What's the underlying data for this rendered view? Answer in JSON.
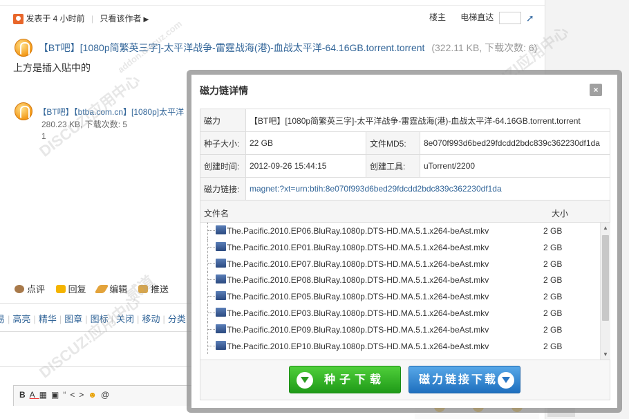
{
  "post": {
    "posted_time": "发表于 4 小时前",
    "only_author": "只看该作者",
    "floor_label": "楼主",
    "elevator_label": "电梯直达",
    "attachment1": {
      "link_text": "【BT吧】[1080p简繁英三字]-太平洋战争-雷霆战海(港)-血战太平洋-64.16GB.torrent.torrent",
      "info": "(322.11 KB, 下载次数: 6)"
    },
    "body_text": "上方是插入贴中的",
    "attachment2": {
      "link_text": "【BT吧】【btba.com.cn】[1080p]太平洋",
      "size_downloads": "280.23 KB, 下载次数: 5",
      "count": "1"
    },
    "actions": [
      "点评",
      "回复",
      "编辑",
      "推送"
    ],
    "admin_actions": [
      "易",
      "高亮",
      "精华",
      "图章",
      "图标",
      "关闭",
      "移动",
      "分类"
    ]
  },
  "editor": {
    "toolbar_items": [
      "B",
      "A",
      "▦",
      "▣",
      "“",
      "<>",
      "☻",
      "@"
    ]
  },
  "watermark": {
    "text1": "DISCUZ!应用中心",
    "text2": "addon.discuz.com",
    "text3": "贰道"
  },
  "modal": {
    "title": "磁力链详情",
    "close": "×",
    "rows": {
      "magnet_label": "磁力",
      "magnet_name": "【BT吧】[1080p简繁英三字]-太平洋战争-雷霆战海(港)-血战太平洋-64.16GB.torrent.torrent",
      "size_label": "种子大小:",
      "size_value": "22 GB",
      "md5_label": "文件MD5:",
      "md5_value": "8e070f993d6bed29fdcdd2bdc839c362230df1da",
      "created_label": "创建时间:",
      "created_value": "2012-09-26 15:44:15",
      "tool_label": "创建工具:",
      "tool_value": "uTorrent/2200",
      "link_label": "磁力链接:",
      "link_value": "magnet:?xt=urn:btih:8e070f993d6bed29fdcdd2bdc839c362230df1da"
    },
    "file_header": {
      "name": "文件名",
      "size": "大小"
    },
    "files": [
      {
        "name": "The.Pacific.2010.EP06.BluRay.1080p.DTS-HD.MA.5.1.x264-beAst.mkv",
        "size": "2 GB"
      },
      {
        "name": "The.Pacific.2010.EP01.BluRay.1080p.DTS-HD.MA.5.1.x264-beAst.mkv",
        "size": "2 GB"
      },
      {
        "name": "The.Pacific.2010.EP07.BluRay.1080p.DTS-HD.MA.5.1.x264-beAst.mkv",
        "size": "2 GB"
      },
      {
        "name": "The.Pacific.2010.EP08.BluRay.1080p.DTS-HD.MA.5.1.x264-beAst.mkv",
        "size": "2 GB"
      },
      {
        "name": "The.Pacific.2010.EP05.BluRay.1080p.DTS-HD.MA.5.1.x264-beAst.mkv",
        "size": "2 GB"
      },
      {
        "name": "The.Pacific.2010.EP03.BluRay.1080p.DTS-HD.MA.5.1.x264-beAst.mkv",
        "size": "2 GB"
      },
      {
        "name": "The.Pacific.2010.EP09.BluRay.1080p.DTS-HD.MA.5.1.x264-beAst.mkv",
        "size": "2 GB"
      },
      {
        "name": "The.Pacific.2010.EP10.BluRay.1080p.DTS-HD.MA.5.1.x264-beAst.mkv",
        "size": "2 GB"
      }
    ],
    "buttons": {
      "seed_download": "种子下载",
      "magnet_download": "磁力链接下载"
    }
  }
}
